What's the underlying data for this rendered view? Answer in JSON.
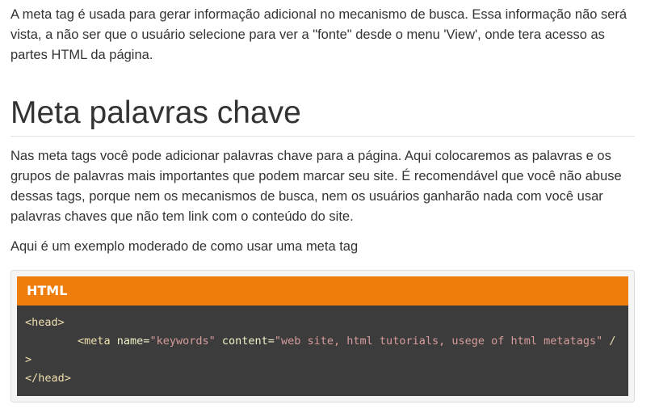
{
  "intro_paragraph": "A meta tag é usada para gerar informação adicional no mecanismo de busca. Essa informação não será vista, a não ser que o usuário selecione para ver a \"fonte\" desde o menu 'View', onde tera acesso as partes HTML da página.",
  "section_heading": "Meta palavras chave",
  "section_paragraph": "Nas meta tags você pode adicionar palavras chave para a página. Aqui colocaremos as palavras e os grupos de palavras mais importantes que podem marcar seu site. É recomendável que você não abuse dessas tags, porque nem os mecanismos de busca, nem os usuários ganharão nada com você usar palavras chaves que não tem link com o conteúdo do site.",
  "example_intro": "Aqui é um exemplo moderado de como usar uma meta tag",
  "example": {
    "header_label": "HTML",
    "header_color": "#ee7d0b",
    "code_background": "#3c3c3c",
    "code": {
      "line1_tag": "<head>",
      "line2_indent": "        ",
      "line2_tag_open": "<meta",
      "line2_attr1_name": " name=",
      "line2_attr1_value": "\"keywords\"",
      "line2_attr2_name": " content=",
      "line2_attr2_value": "\"web site, html tutorials, usege of html metatags\"",
      "line2_tag_close": " />",
      "line3_tag": "</head>"
    }
  }
}
